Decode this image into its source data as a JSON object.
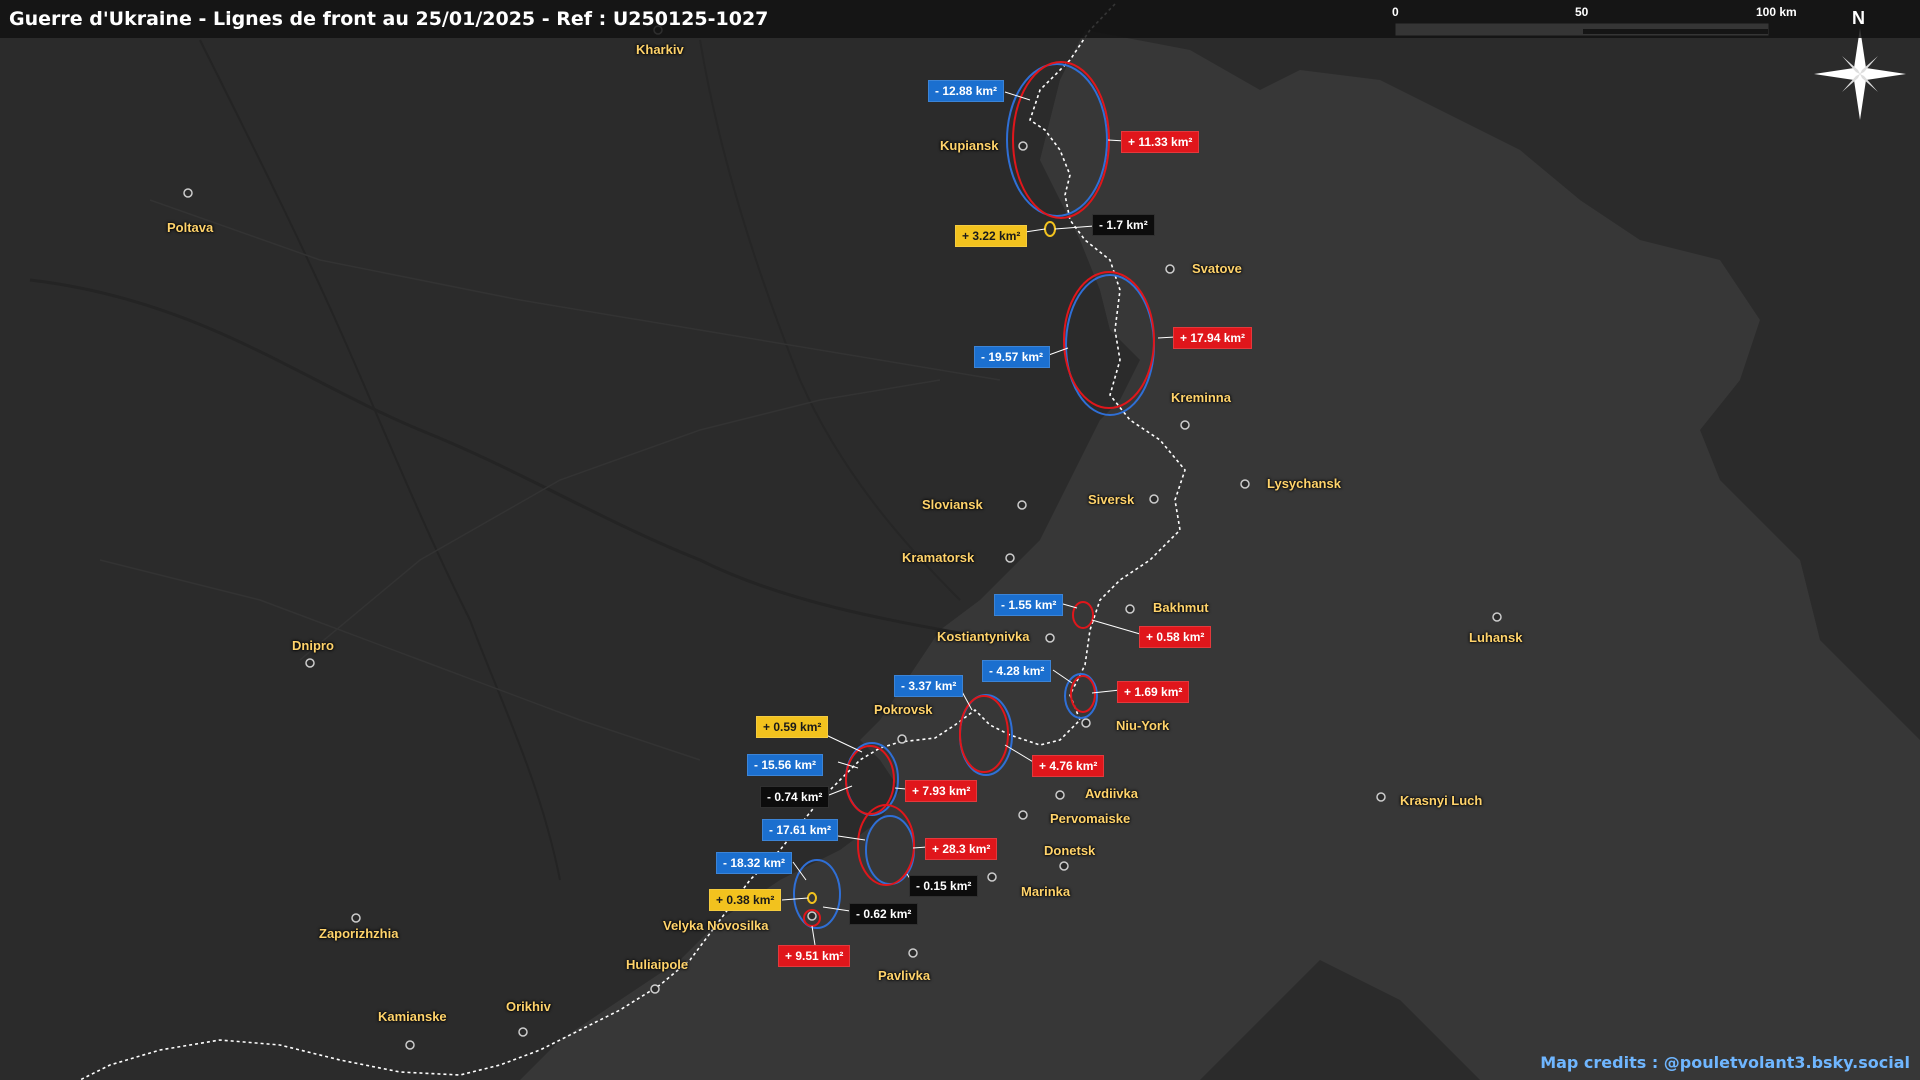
{
  "title": "Guerre d'Ukraine - Lignes de front au 25/01/2025 - Ref : U250125-1027",
  "credits": "Map credits : @pouletvolant3.bsky.social",
  "scale": {
    "labels": [
      "0",
      "50",
      "100 km"
    ]
  },
  "north": "N",
  "colors": {
    "gain": "#e0161b",
    "loss": "#1b6fcf",
    "minor_loss": "#0c0c0c",
    "minor_gain": "#f2c21e",
    "city": "#ffd36b",
    "front_line": "#ffffff"
  },
  "cities": [
    "Kharkiv",
    "Kupiansk",
    "Poltava",
    "Svatove",
    "Kreminna",
    "Lysychansk",
    "Siversk",
    "Sloviansk",
    "Kramatorsk",
    "Bakhmut",
    "Kostiantynivka",
    "Luhansk",
    "Dnipro",
    "Pokrovsk",
    "Niu-York",
    "Avdiivka",
    "Pervomaiske",
    "Donetsk",
    "Marinka",
    "Krasnyi Luch",
    "Velyka Novosilka",
    "Zaporizhzhia",
    "Huliaipole",
    "Pavlivka",
    "Orikhiv",
    "Kamianske"
  ],
  "area_changes": [
    {
      "label": "- 12.88 km²",
      "type": "loss"
    },
    {
      "label": "+ 11.33 km²",
      "type": "gain"
    },
    {
      "label": "+ 3.22 km²",
      "type": "minor_gain"
    },
    {
      "label": "- 1.7 km²",
      "type": "minor_loss"
    },
    {
      "label": "+ 17.94 km²",
      "type": "gain"
    },
    {
      "label": "- 19.57 km²",
      "type": "loss"
    },
    {
      "label": "- 1.55 km²",
      "type": "loss"
    },
    {
      "label": "+ 0.58 km²",
      "type": "gain"
    },
    {
      "label": "- 4.28 km²",
      "type": "loss"
    },
    {
      "label": "+ 1.69 km²",
      "type": "gain"
    },
    {
      "label": "- 3.37 km²",
      "type": "loss"
    },
    {
      "label": "+ 4.76 km²",
      "type": "gain"
    },
    {
      "label": "+ 0.59 km²",
      "type": "minor_gain"
    },
    {
      "label": "- 15.56 km²",
      "type": "loss"
    },
    {
      "label": "- 0.74 km²",
      "type": "minor_loss"
    },
    {
      "label": "+ 7.93 km²",
      "type": "gain"
    },
    {
      "label": "- 17.61 km²",
      "type": "loss"
    },
    {
      "label": "+ 28.3 km²",
      "type": "gain"
    },
    {
      "label": "- 0.15 km²",
      "type": "minor_loss"
    },
    {
      "label": "- 18.32 km²",
      "type": "loss"
    },
    {
      "label": "+ 0.38 km²",
      "type": "minor_gain"
    },
    {
      "label": "- 0.62 km²",
      "type": "minor_loss"
    },
    {
      "label": "+ 9.51 km²",
      "type": "gain"
    }
  ]
}
